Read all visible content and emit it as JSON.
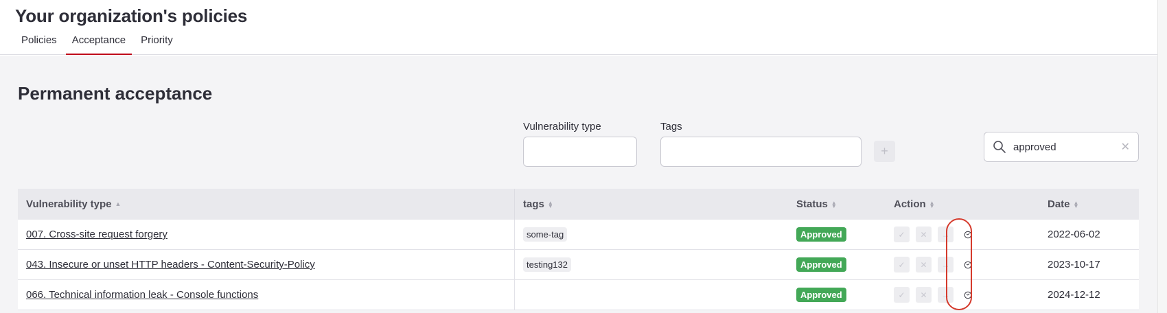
{
  "header": {
    "title": "Your organization's policies",
    "tabs": [
      {
        "label": "Policies",
        "active": false
      },
      {
        "label": "Acceptance",
        "active": true
      },
      {
        "label": "Priority",
        "active": false
      }
    ]
  },
  "section": {
    "title": "Permanent acceptance"
  },
  "form": {
    "vuln_label": "Vulnerability type",
    "vuln_value": "",
    "tags_label": "Tags",
    "tags_value": "",
    "add_label": "+"
  },
  "search": {
    "value": "approved",
    "icon": "search-icon",
    "clear_icon": "close-icon"
  },
  "table": {
    "columns": [
      "Vulnerability type",
      "tags",
      "Status",
      "Action",
      "Date"
    ],
    "rows": [
      {
        "vuln": "007. Cross-site request forgery",
        "tag": "some-tag",
        "status": "Approved",
        "date": "2022-06-02"
      },
      {
        "vuln": "043. Insecure or unset HTTP headers - Content-Security-Policy",
        "tag": "testing132",
        "status": "Approved",
        "date": "2023-10-17"
      },
      {
        "vuln": "066. Technical information leak - Console functions",
        "tag": "",
        "status": "Approved",
        "date": "2024-12-12"
      }
    ],
    "action_icons": [
      "check-icon",
      "close-icon",
      "arrow-right-icon",
      "clock-icon"
    ]
  },
  "colors": {
    "accent": "#bf0b1a",
    "approved": "#43a857",
    "highlight": "#d53a2c"
  }
}
